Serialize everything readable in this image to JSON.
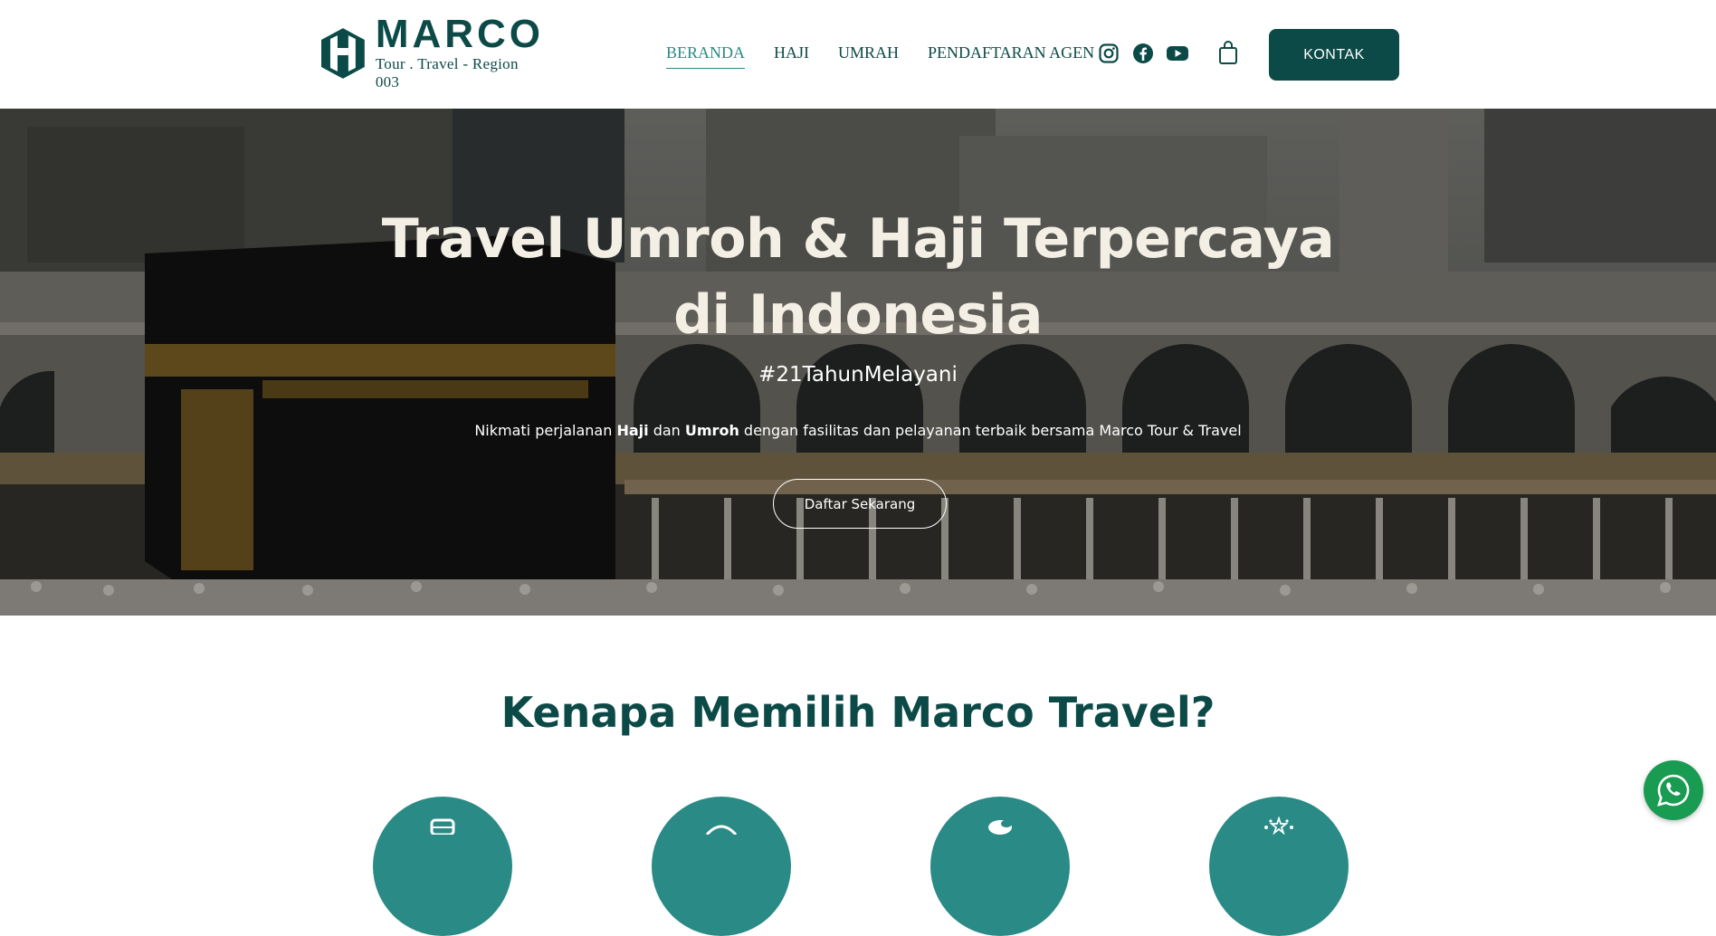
{
  "brand": {
    "name": "MARCO",
    "tagline": "Tour . Travel - Region 003",
    "color": "#0c4a47"
  },
  "nav": {
    "items": [
      {
        "label": "BERANDA",
        "active": true
      },
      {
        "label": "HAJI",
        "active": false
      },
      {
        "label": "UMRAH",
        "active": false
      },
      {
        "label": "PENDAFTARAN AGEN",
        "active": false
      }
    ],
    "social_icons": [
      "instagram-icon",
      "facebook-icon",
      "youtube-icon"
    ],
    "cart_icon": "shopping-bag-icon",
    "contact_label": "KONTAK"
  },
  "hero": {
    "title_line1": "Travel Umroh & Haji Terpercaya",
    "title_line2": "di Indonesia",
    "hashtag": "#21TahunMelayani",
    "desc_pre": "Nikmati perjalanan ",
    "desc_bold1": "Haji",
    "desc_mid": " dan ",
    "desc_bold2": "Umroh",
    "desc_post": " dengan fasilitas dan pelayanan terbaik bersama Marco Tour & Travel",
    "cta_label": "Daftar Sekarang"
  },
  "why": {
    "title": "Kenapa Memilih Marco Travel?",
    "feature_icons": [
      "luggage-icon",
      "plane-icon",
      "leaf-icon",
      "stars-icon"
    ]
  },
  "whatsapp_icon": "whatsapp-icon",
  "colors": {
    "accent": "#2a8a86",
    "dark": "#0c4a47",
    "whatsapp": "#1a9b52"
  }
}
